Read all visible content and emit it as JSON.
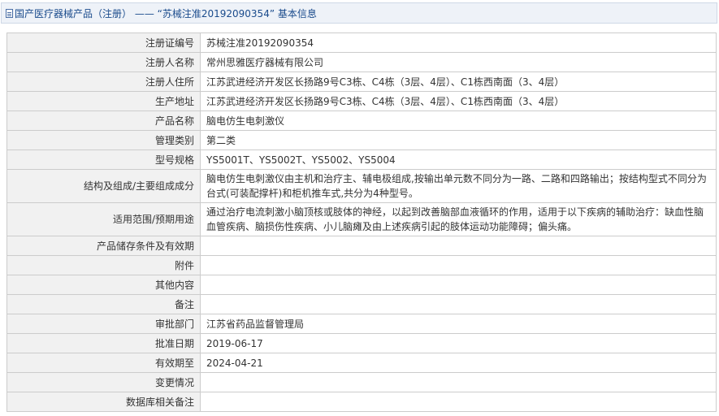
{
  "header": {
    "title": "国产医疗器械产品（注册） —— “苏械注准20192090354” 基本信息"
  },
  "rows": [
    {
      "label": "注册证编号",
      "value": "苏械注准20192090354"
    },
    {
      "label": "注册人名称",
      "value": "常州思雅医疗器械有限公司"
    },
    {
      "label": "注册人住所",
      "value": "江苏武进经济开发区长扬路9号C3栋、C4栋（3层、4层）、C1栋西南面（3、4层）"
    },
    {
      "label": "生产地址",
      "value": "江苏武进经济开发区长扬路9号C3栋、C4栋（3层、4层）、C1栋西南面（3、4层）"
    },
    {
      "label": "产品名称",
      "value": "脑电仿生电刺激仪"
    },
    {
      "label": "管理类别",
      "value": "第二类"
    },
    {
      "label": "型号规格",
      "value": "YS5001T、YS5002T、YS5002、YS5004"
    },
    {
      "label": "结构及组成/主要组成成分",
      "value": "脑电仿生电刺激仪由主机和治疗主、辅电极组成,按输出单元数不同分为一路、二路和四路输出；按结构型式不同分为台式(可装配撑杆)和柜机推车式,共分为4种型号。"
    },
    {
      "label": "适用范围/预期用途",
      "value": "通过治疗电流刺激小脑顶核或肢体的神经，以起到改善脑部血液循环的作用，适用于以下疾病的辅助治疗：缺血性脑血管疾病、脑损伤性疾病、小儿脑瘫及由上述疾病引起的肢体运动功能障碍；偏头痛。"
    },
    {
      "label": "产品储存条件及有效期",
      "value": ""
    },
    {
      "label": "附件",
      "value": ""
    },
    {
      "label": "其他内容",
      "value": ""
    },
    {
      "label": "备注",
      "value": ""
    },
    {
      "label": "审批部门",
      "value": "江苏省药品监督管理局"
    },
    {
      "label": "批准日期",
      "value": "2019-06-17"
    },
    {
      "label": "有效期至",
      "value": "2024-04-21"
    },
    {
      "label": "变更情况",
      "value": ""
    },
    {
      "label": "数据库相关备注",
      "value": ""
    }
  ]
}
